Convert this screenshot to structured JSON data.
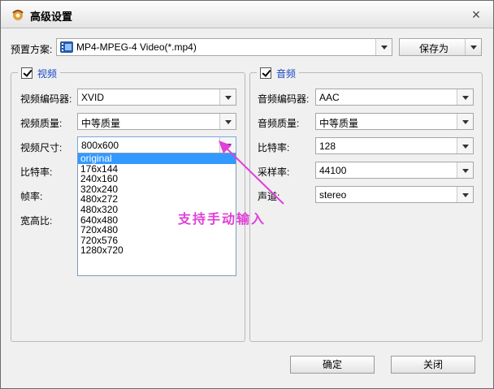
{
  "window": {
    "title": "高级设置",
    "title_icon": "app-logo-icon",
    "close_glyph": "×"
  },
  "preset": {
    "label": "预置方案:",
    "value": "MP4-MPEG-4 Video(*.mp4)",
    "icon": "film-icon",
    "save_as_label": "保存为"
  },
  "video": {
    "legend": "视频",
    "checked": true,
    "fields": {
      "encoder_label": "视频编码器:",
      "encoder_value": "XVID",
      "quality_label": "视频质量:",
      "quality_value": "中等质量",
      "size_label": "视频尺寸:",
      "size_value": "800x600",
      "bitrate_label": "比特率:",
      "framerate_label": "帧率:",
      "aspect_label": "宽高比:"
    },
    "size_options": [
      "original",
      "176x144",
      "240x160",
      "320x240",
      "480x272",
      "480x320",
      "640x480",
      "720x480",
      "720x576",
      "1280x720"
    ],
    "size_options_highlighted": "original"
  },
  "audio": {
    "legend": "音频",
    "checked": true,
    "fields": {
      "encoder_label": "音频编码器:",
      "encoder_value": "AAC",
      "quality_label": "音频质量:",
      "quality_value": "中等质量",
      "bitrate_label": "比特率:",
      "bitrate_value": "128",
      "samplerate_label": "采样率:",
      "samplerate_value": "44100",
      "channel_label": "声道:",
      "channel_value": "stereo"
    }
  },
  "annotation": {
    "text": "支持手动输入",
    "color": "#e040d8"
  },
  "buttons": {
    "ok": "确定",
    "close": "关闭"
  },
  "colors": {
    "legend": "#1a47c0",
    "selection": "#3399ff",
    "window_bg": "#f0f0f0"
  }
}
